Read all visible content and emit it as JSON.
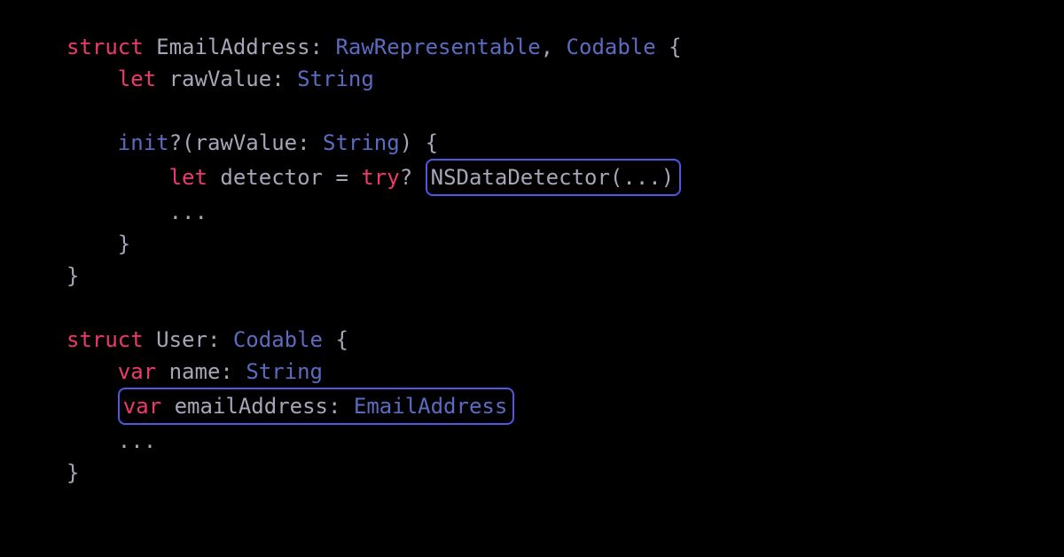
{
  "line1": {
    "struct": "struct",
    "name": "EmailAddress",
    "colon": ":",
    "proto1": "RawRepresentable",
    "comma": ",",
    "proto2": "Codable",
    "brace": "{"
  },
  "line2": {
    "let": "let",
    "name": "rawValue",
    "colon": ":",
    "type": "String"
  },
  "line4": {
    "init": "init",
    "q": "?",
    "open": "(",
    "param": "rawValue",
    "colon": ":",
    "type": "String",
    "close": ")",
    "brace": "{"
  },
  "line5": {
    "let": "let",
    "name": "detector",
    "eq": "=",
    "try": "try",
    "q": "?",
    "call": "NSDataDetector",
    "open": "(",
    "dots": "...",
    "close": ")"
  },
  "line6": {
    "dots": "..."
  },
  "line7": {
    "brace": "}"
  },
  "line8": {
    "brace": "}"
  },
  "line10": {
    "struct": "struct",
    "name": "User",
    "colon": ":",
    "proto": "Codable",
    "brace": "{"
  },
  "line11": {
    "var": "var",
    "name": "name",
    "colon": ":",
    "type": "String"
  },
  "line12": {
    "var": "var",
    "name": "emailAddress",
    "colon": ":",
    "type": "EmailAddress"
  },
  "line13": {
    "dots": "..."
  },
  "line14": {
    "brace": "}"
  }
}
